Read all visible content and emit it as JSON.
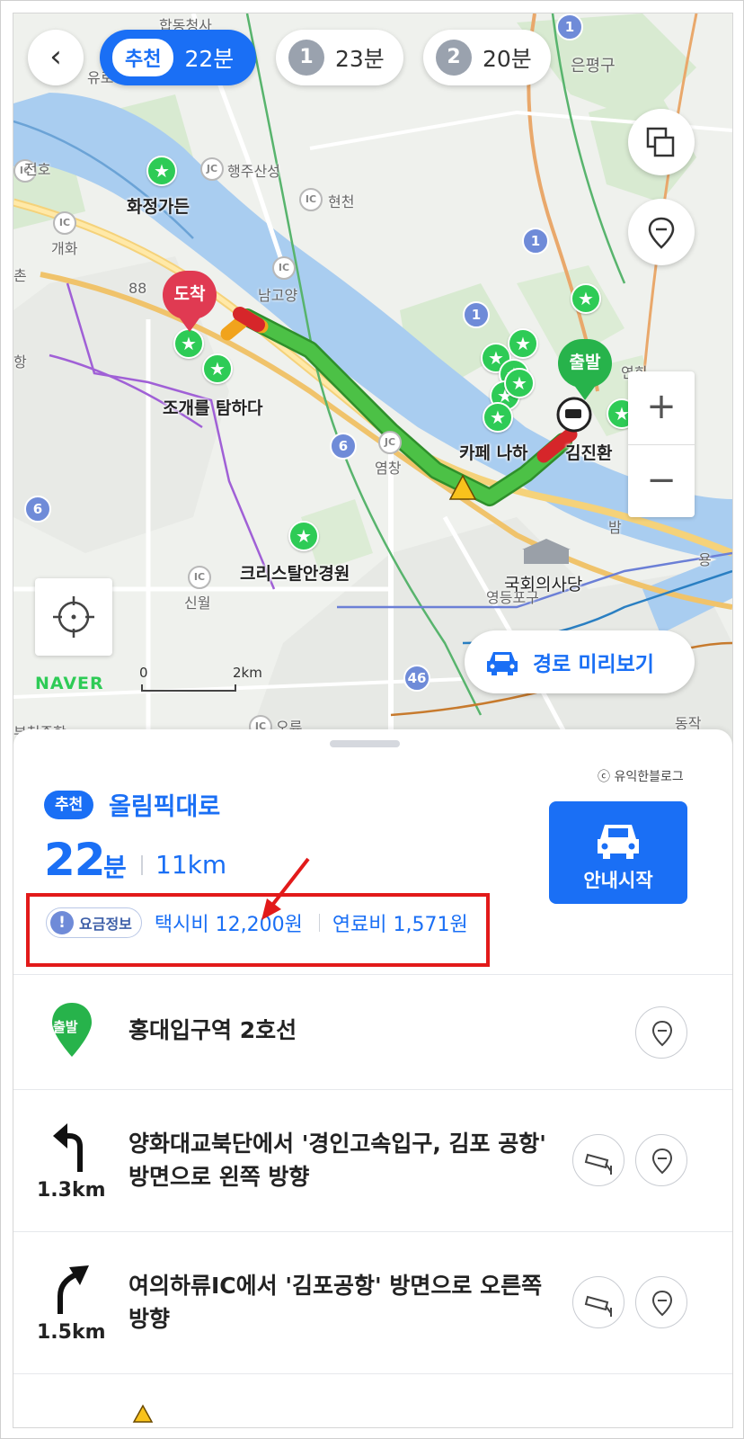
{
  "route_tabs": [
    {
      "badge": "추천",
      "time": "22분",
      "active": true
    },
    {
      "badge": "1",
      "time": "23분",
      "active": false
    },
    {
      "badge": "2",
      "time": "20분",
      "active": false
    }
  ],
  "map": {
    "places": {
      "hwajeong": "화정가든",
      "jogae": "조개를 탐하다",
      "cafe": "카페 나하",
      "crystal": "크리스탈안경원",
      "kimjinhwan": "김진환",
      "assembly": "국회의사당"
    },
    "labels": {
      "hapdong": "합동청사",
      "eunpyeong": "은평구",
      "haengju": "행주산성",
      "hyeoncheon": "현천",
      "namgoyang": "남고양",
      "jeonho": "전호",
      "gaehwa": "개화",
      "yeomchang": "염창",
      "sinwol": "신월",
      "yeonhui": "연희",
      "yeongdeungpo": "영등포구",
      "dongjak": "동작",
      "bam": "밤",
      "chon": "촌",
      "hang": "항",
      "oreu": "오류",
      "yuro": "유로",
      "bucheon": "부천종합",
      "yong": "용"
    },
    "route_numbers": [
      "1",
      "1",
      "1",
      "6",
      "6",
      "46",
      "88"
    ],
    "arrival_pin": "도착",
    "departure_pin": "출발",
    "logo": "NAVER",
    "scale_start": "0",
    "scale_end": "2km",
    "preview_button": "경로 미리보기",
    "zoom_in": "+",
    "zoom_out": "−"
  },
  "summary": {
    "copyright": "ⓒ 유익한블로그",
    "badge": "추천",
    "road": "올림픽대로",
    "duration": "22",
    "duration_unit": "분",
    "distance": "11km",
    "fare_info_label": "요금정보",
    "taxi_fare": "택시비 12,200원",
    "fuel_cost": "연료비 1,571원",
    "start_button": "안내시작"
  },
  "steps": [
    {
      "icon": "departure-pin",
      "badge": "출발",
      "title": "홍대입구역 2호선",
      "distance": ""
    },
    {
      "icon": "turn-left-arrow",
      "title": "양화대교북단에서 '경인고속입구, 김포 공항' 방면으로 왼쪽 방향",
      "distance": "1.3km"
    },
    {
      "icon": "turn-right-arrow",
      "title": "여의하류IC에서 '김포공항' 방면으로 오른쪽 방향",
      "distance": "1.5km"
    }
  ],
  "colors": {
    "accent": "#1a6ff5",
    "route_green": "#4cc146",
    "traffic_red": "#d6262a",
    "highlight_red": "#e21a1a",
    "poi_green": "#2ecb56"
  }
}
